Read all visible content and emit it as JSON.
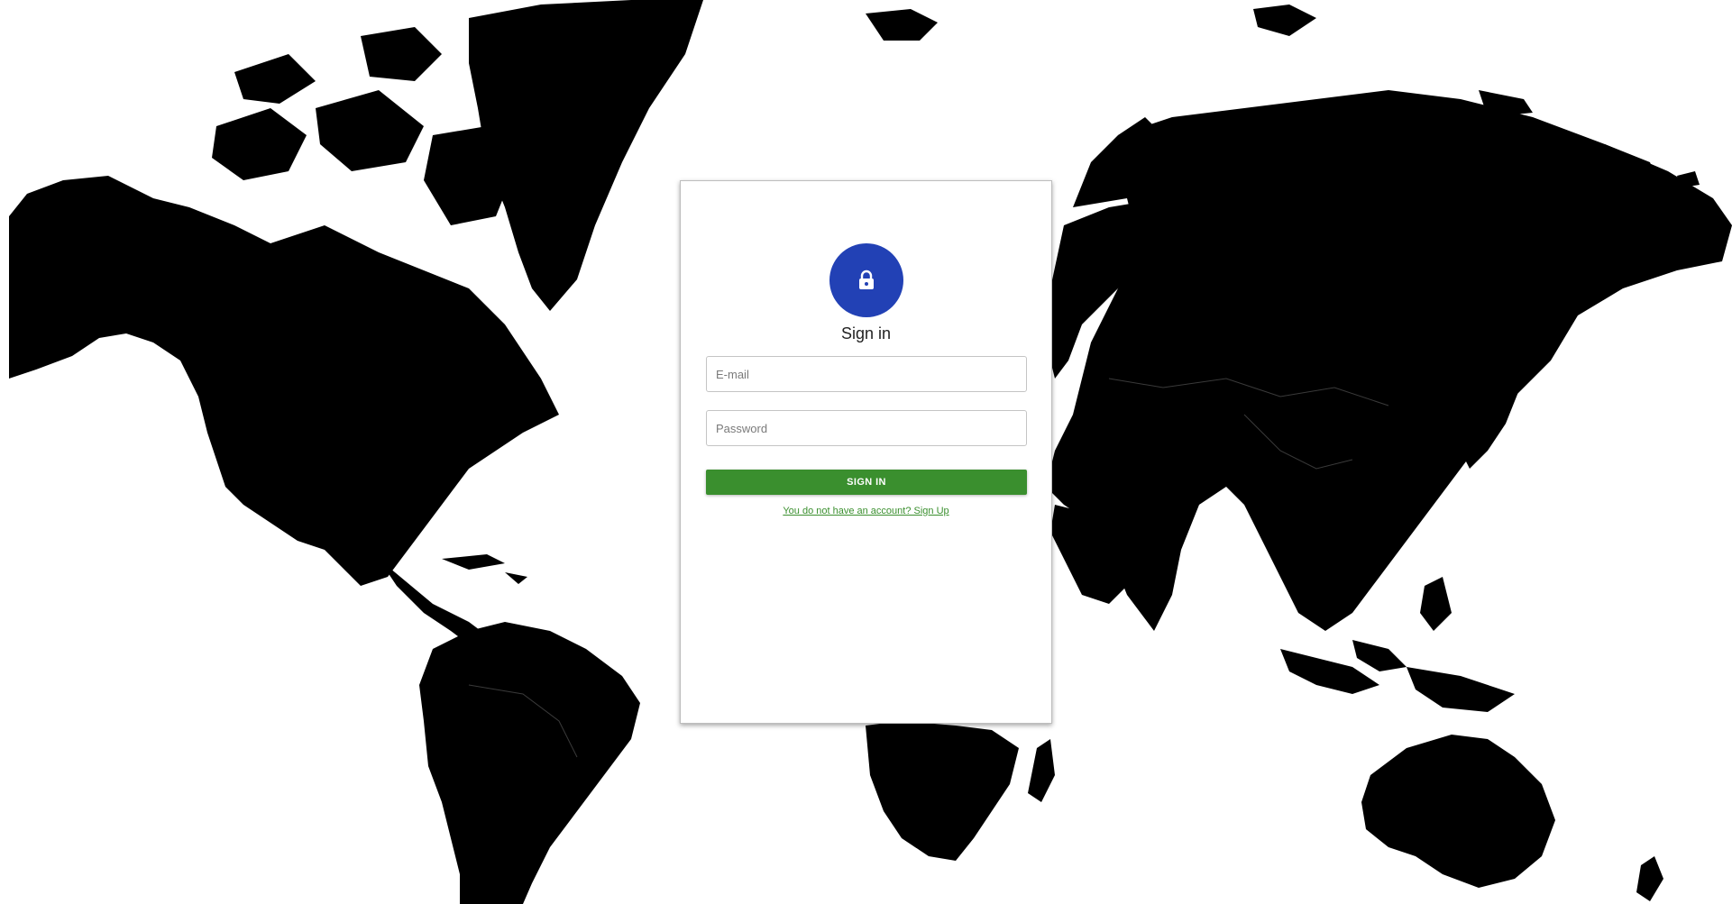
{
  "login": {
    "title": "Sign in",
    "email_placeholder": "E-mail",
    "email_value": "",
    "password_placeholder": "Password",
    "password_value": "",
    "submit_label": "SIGN IN",
    "signup_link": "You do not have an account? Sign Up"
  },
  "icons": {
    "avatar": "lock-icon"
  },
  "colors": {
    "avatar_bg": "#2241b5",
    "submit_bg": "#3a8f2e",
    "link": "#3a8f2e",
    "map_land": "#000000",
    "page_bg": "#ffffff"
  }
}
